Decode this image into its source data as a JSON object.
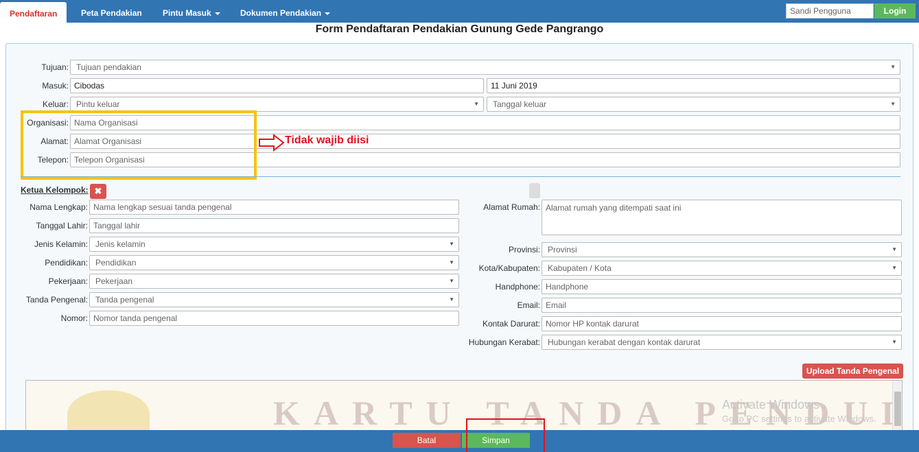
{
  "nav": {
    "tabs": [
      "Pendaftaran",
      "Peta Pendakian",
      "Pintu Masuk",
      "Dokumen Pendakian"
    ],
    "login_placeholder": "Sandi Pengguna",
    "login_button": "Login"
  },
  "title": "Form Pendaftaran Pendakian Gunung Gede Pangrango",
  "trip": {
    "tujuan_label": "Tujuan:",
    "tujuan_value": "Tujuan pendakian",
    "masuk_label": "Masuk:",
    "masuk_value": "Cibodas",
    "masuk_date": "11 Juni 2019",
    "keluar_label": "Keluar:",
    "keluar_value": "Pintu keluar",
    "keluar_date": "Tanggal keluar",
    "organisasi_label": "Organisasi:",
    "organisasi_placeholder": "Nama Organisasi",
    "alamat_label": "Alamat:",
    "alamat_placeholder": "Alamat Organisasi",
    "telepon_label": "Telepon:",
    "telepon_placeholder": "Telepon Organisasi"
  },
  "annotation": "Tidak wajib diisi",
  "ketua": {
    "heading": "Ketua Kelompok:",
    "remove_icon": "✖",
    "left": [
      {
        "label": "Nama Lengkap:",
        "value": "Nama lengkap sesuai tanda pengenal",
        "type": "input"
      },
      {
        "label": "Tanggal Lahir:",
        "value": "Tanggal lahir",
        "type": "input"
      },
      {
        "label": "Jenis Kelamin:",
        "value": "Jenis kelamin",
        "type": "select"
      },
      {
        "label": "Pendidikan:",
        "value": "Pendidikan",
        "type": "select"
      },
      {
        "label": "Pekerjaan:",
        "value": "Pekerjaan",
        "type": "select"
      },
      {
        "label": "Tanda Pengenal:",
        "value": "Tanda pengenal",
        "type": "select"
      },
      {
        "label": "Nomor:",
        "value": "Nomor tanda pengenal",
        "type": "input"
      }
    ],
    "alamat_rumah_label": "Alamat Rumah:",
    "alamat_rumah_placeholder": "Alamat rumah yang ditempati saat ini",
    "right": [
      {
        "label": "Provinsi:",
        "value": "Provinsi",
        "type": "select"
      },
      {
        "label": "Kota/Kabupaten:",
        "value": "Kabupaten / Kota",
        "type": "select"
      },
      {
        "label": "Handphone:",
        "value": "Handphone",
        "type": "input"
      },
      {
        "label": "Email:",
        "value": "Email",
        "type": "input"
      },
      {
        "label": "Kontak Darurat:",
        "value": "Nomor HP kontak darurat",
        "type": "input"
      },
      {
        "label": "Hubungan Kerabat:",
        "value": "Hubungan kerabat dengan kontak darurat",
        "type": "select"
      }
    ]
  },
  "upload_button": "Upload Tanda Pengenal",
  "preview_text": "KARTU TANDA PENDUDUK",
  "activate": {
    "line1": "Activate Windows",
    "line2": "Go to PC settings to activate Windows."
  },
  "footer": {
    "batal": "Batal",
    "simpan": "Simpan"
  },
  "colors": {
    "navbar": "#3175b3",
    "danger": "#d9534f",
    "success": "#5cb85c",
    "highlight_yellow": "#f7c30b",
    "highlight_red": "#e0141e"
  }
}
